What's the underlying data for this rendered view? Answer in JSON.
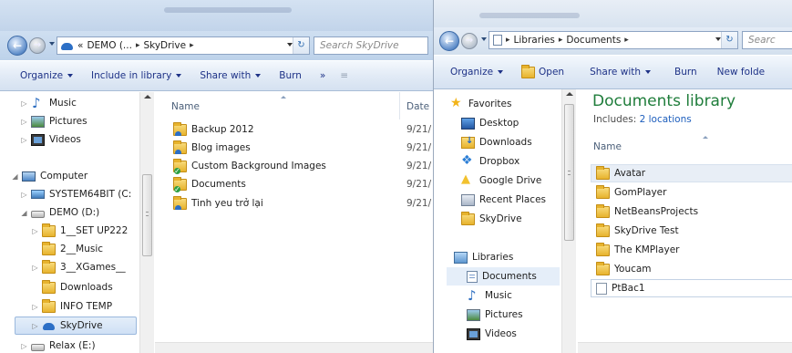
{
  "left_window": {
    "address": {
      "crumbs": [
        "«",
        "DEMO (...",
        "SkyDrive"
      ],
      "search_placeholder": "Search SkyDrive"
    },
    "toolbar": {
      "organize": "Organize",
      "include_in_library": "Include in library",
      "share_with": "Share with",
      "burn": "Burn",
      "more": "»",
      "view_glyph": "≡"
    },
    "nav": {
      "items": [
        {
          "label": "Music",
          "icon": "music-icon"
        },
        {
          "label": "Pictures",
          "icon": "pictures-icon"
        },
        {
          "label": "Videos",
          "icon": "videos-icon"
        },
        {
          "label": "Computer",
          "icon": "computer-icon"
        },
        {
          "label": "SYSTEM64BIT (C:",
          "icon": "system-drive-icon"
        },
        {
          "label": "DEMO (D:)",
          "icon": "drive-icon"
        },
        {
          "label": "1__SET UP222",
          "icon": "folder-icon"
        },
        {
          "label": "2__Music",
          "icon": "folder-icon"
        },
        {
          "label": "3__XGames__",
          "icon": "folder-icon"
        },
        {
          "label": "Downloads",
          "icon": "folder-icon"
        },
        {
          "label": "INFO TEMP",
          "icon": "folder-icon"
        },
        {
          "label": "SkyDrive",
          "icon": "skydrive-icon"
        },
        {
          "label": "Relax (E:)",
          "icon": "drive-icon"
        }
      ]
    },
    "content": {
      "col_name": "Name",
      "col_date": "Date",
      "files": [
        {
          "name": "Backup 2012",
          "date": "9/21/",
          "icon": "skydrive-folder-icon"
        },
        {
          "name": "Blog images",
          "date": "9/21/",
          "icon": "skydrive-folder-icon"
        },
        {
          "name": "Custom Background Images",
          "date": "9/21/",
          "icon": "synced-folder-icon"
        },
        {
          "name": "Documents",
          "date": "9/21/",
          "icon": "synced-folder-icon"
        },
        {
          "name": "Tinh yeu trở lại",
          "date": "9/21/",
          "icon": "skydrive-folder-icon"
        }
      ]
    }
  },
  "right_window": {
    "address": {
      "crumbs": [
        "Libraries",
        "Documents"
      ],
      "search_placeholder": "Searc"
    },
    "toolbar": {
      "organize": "Organize",
      "open": "Open",
      "share_with": "Share with",
      "burn": "Burn",
      "new_folder": "New folde"
    },
    "nav": {
      "favorites_label": "Favorites",
      "favorites": [
        {
          "label": "Desktop",
          "icon": "desktop-icon"
        },
        {
          "label": "Downloads",
          "icon": "downloads-icon"
        },
        {
          "label": "Dropbox",
          "icon": "dropbox-icon"
        },
        {
          "label": "Google Drive",
          "icon": "google-drive-icon"
        },
        {
          "label": "Recent Places",
          "icon": "recent-places-icon"
        },
        {
          "label": "SkyDrive",
          "icon": "folder-icon"
        }
      ],
      "libraries_label": "Libraries",
      "libraries": [
        {
          "label": "Documents",
          "icon": "documents-library-icon"
        },
        {
          "label": "Music",
          "icon": "music-icon"
        },
        {
          "label": "Pictures",
          "icon": "pictures-icon"
        },
        {
          "label": "Videos",
          "icon": "videos-icon"
        }
      ]
    },
    "content": {
      "title": "Documents library",
      "includes_prefix": "Includes:",
      "includes_link": "2 locations",
      "col_name": "Name",
      "files": [
        {
          "name": "Avatar",
          "icon": "folder-icon"
        },
        {
          "name": "GomPlayer",
          "icon": "folder-icon"
        },
        {
          "name": "NetBeansProjects",
          "icon": "folder-icon"
        },
        {
          "name": "SkyDrive Test",
          "icon": "folder-icon"
        },
        {
          "name": "The KMPlayer",
          "icon": "folder-icon"
        },
        {
          "name": "Youcam",
          "icon": "folder-icon"
        },
        {
          "name": "PtBac1",
          "icon": "document-icon"
        }
      ]
    }
  }
}
